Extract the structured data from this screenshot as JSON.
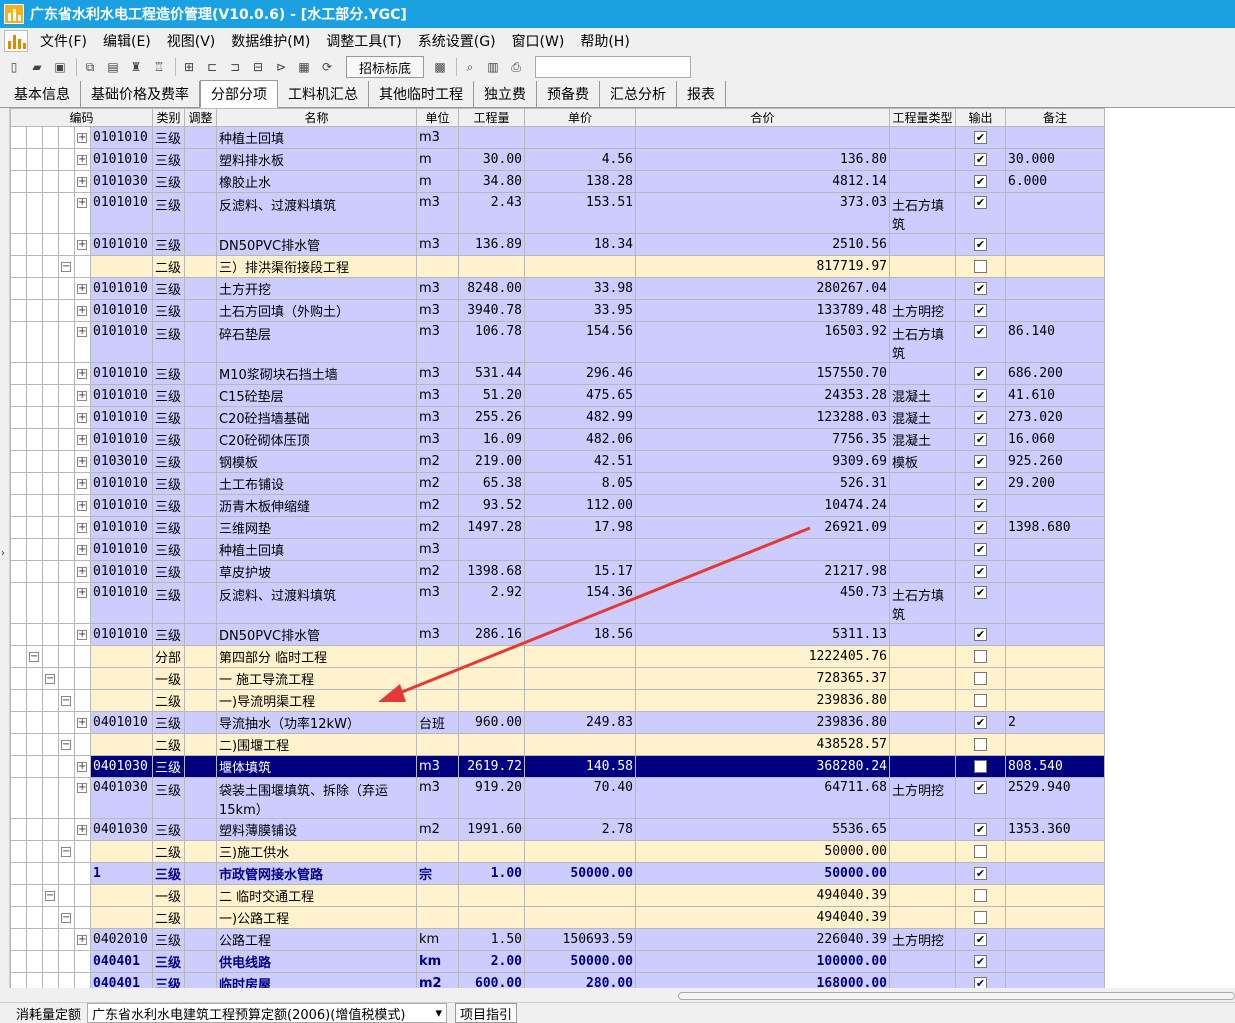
{
  "window": {
    "title": "广东省水利水电工程造价管理(V10.0.6) - [水工部分.YGC]"
  },
  "menu": [
    "文件(F)",
    "编辑(E)",
    "视图(V)",
    "数据维护(M)",
    "调整工具(T)",
    "系统设置(G)",
    "窗口(W)",
    "帮助(H)"
  ],
  "toolbar": {
    "bid_button": "招标标底"
  },
  "tabs": [
    "基本信息",
    "基础价格及费率",
    "分部分项",
    "工料机汇总",
    "其他临时工程",
    "独立费",
    "预备费",
    "汇总分析",
    "报表"
  ],
  "active_tab": 2,
  "columns": [
    "编码",
    "类别",
    "调整",
    "名称",
    "单位",
    "工程量",
    "单价",
    "合价",
    "工程量类型",
    "输出",
    "备注"
  ],
  "rows": [
    {
      "code": "0101010",
      "cat": "三级",
      "name": "种植土回填",
      "unit": "m3",
      "qty": "",
      "price": "",
      "total": "",
      "qtype": "",
      "out": "✔",
      "note": ""
    },
    {
      "code": "0101010",
      "cat": "三级",
      "name": "塑料排水板",
      "unit": "m",
      "qty": "30.00",
      "price": "4.56",
      "total": "136.80",
      "qtype": "",
      "out": "✔",
      "note": "30.000"
    },
    {
      "code": "0101030",
      "cat": "三级",
      "name": "橡胶止水",
      "unit": "m",
      "qty": "34.80",
      "price": "138.28",
      "total": "4812.14",
      "qtype": "",
      "out": "✔",
      "note": "6.000"
    },
    {
      "code": "0101010",
      "cat": "三级",
      "name": "反滤料、过渡料填筑",
      "unit": "m3",
      "qty": "2.43",
      "price": "153.51",
      "total": "373.03",
      "qtype": "土石方填筑",
      "out": "✔",
      "note": ""
    },
    {
      "code": "0101010",
      "cat": "三级",
      "name": "DN50PVC排水管",
      "unit": "m3",
      "qty": "136.89",
      "price": "18.34",
      "total": "2510.56",
      "qtype": "",
      "out": "✔",
      "note": ""
    },
    {
      "code": "",
      "cat": "二级",
      "name": "三）排洪渠衔接段工程",
      "unit": "",
      "qty": "",
      "price": "",
      "total": "817719.97",
      "qtype": "",
      "out": "",
      "note": ""
    },
    {
      "code": "0101010",
      "cat": "三级",
      "name": "土方开挖",
      "unit": "m3",
      "qty": "8248.00",
      "price": "33.98",
      "total": "280267.04",
      "qtype": "",
      "out": "✔",
      "note": ""
    },
    {
      "code": "0101010",
      "cat": "三级",
      "name": "土石方回填（外购土）",
      "unit": "m3",
      "qty": "3940.78",
      "price": "33.95",
      "total": "133789.48",
      "qtype": "土方明挖",
      "out": "✔",
      "note": ""
    },
    {
      "code": "0101010",
      "cat": "三级",
      "name": "碎石垫层",
      "unit": "m3",
      "qty": "106.78",
      "price": "154.56",
      "total": "16503.92",
      "qtype": "土石方填筑",
      "out": "✔",
      "note": "86.140"
    },
    {
      "code": "0101010",
      "cat": "三级",
      "name": "M10浆砌块石挡土墙",
      "unit": "m3",
      "qty": "531.44",
      "price": "296.46",
      "total": "157550.70",
      "qtype": "",
      "out": "✔",
      "note": "686.200"
    },
    {
      "code": "0101010",
      "cat": "三级",
      "name": "C15砼垫层",
      "unit": "m3",
      "qty": "51.20",
      "price": "475.65",
      "total": "24353.28",
      "qtype": "混凝土",
      "out": "✔",
      "note": "41.610"
    },
    {
      "code": "0101010",
      "cat": "三级",
      "name": "C20砼挡墙基础",
      "unit": "m3",
      "qty": "255.26",
      "price": "482.99",
      "total": "123288.03",
      "qtype": "混凝土",
      "out": "✔",
      "note": "273.020"
    },
    {
      "code": "0101010",
      "cat": "三级",
      "name": "C20砼砌体压顶",
      "unit": "m3",
      "qty": "16.09",
      "price": "482.06",
      "total": "7756.35",
      "qtype": "混凝土",
      "out": "✔",
      "note": "16.060"
    },
    {
      "code": "0103010",
      "cat": "三级",
      "name": "钢模板",
      "unit": "m2",
      "qty": "219.00",
      "price": "42.51",
      "total": "9309.69",
      "qtype": "模板",
      "out": "✔",
      "note": "925.260"
    },
    {
      "code": "0101010",
      "cat": "三级",
      "name": "土工布铺设",
      "unit": "m2",
      "qty": "65.38",
      "price": "8.05",
      "total": "526.31",
      "qtype": "",
      "out": "✔",
      "note": "29.200"
    },
    {
      "code": "0101010",
      "cat": "三级",
      "name": "沥青木板伸缩缝",
      "unit": "m2",
      "qty": "93.52",
      "price": "112.00",
      "total": "10474.24",
      "qtype": "",
      "out": "✔",
      "note": ""
    },
    {
      "code": "0101010",
      "cat": "三级",
      "name": "三维网垫",
      "unit": "m2",
      "qty": "1497.28",
      "price": "17.98",
      "total": "26921.09",
      "qtype": "",
      "out": "✔",
      "note": "1398.680"
    },
    {
      "code": "0101010",
      "cat": "三级",
      "name": "种植土回填",
      "unit": "m3",
      "qty": "",
      "price": "",
      "total": "",
      "qtype": "",
      "out": "✔",
      "note": ""
    },
    {
      "code": "0101010",
      "cat": "三级",
      "name": "草皮护坡",
      "unit": "m2",
      "qty": "1398.68",
      "price": "15.17",
      "total": "21217.98",
      "qtype": "",
      "out": "✔",
      "note": ""
    },
    {
      "code": "0101010",
      "cat": "三级",
      "name": "反滤料、过渡料填筑",
      "unit": "m3",
      "qty": "2.92",
      "price": "154.36",
      "total": "450.73",
      "qtype": "土石方填筑",
      "out": "✔",
      "note": ""
    },
    {
      "code": "0101010",
      "cat": "三级",
      "name": "DN50PVC排水管",
      "unit": "m3",
      "qty": "286.16",
      "price": "18.56",
      "total": "5311.13",
      "qtype": "",
      "out": "✔",
      "note": ""
    },
    {
      "code": "",
      "cat": "分部",
      "name": "第四部分  临时工程",
      "unit": "",
      "qty": "",
      "price": "",
      "total": "1222405.76",
      "qtype": "",
      "out": "",
      "note": ""
    },
    {
      "code": "",
      "cat": "一级",
      "name": "一  施工导流工程",
      "unit": "",
      "qty": "",
      "price": "",
      "total": "728365.37",
      "qtype": "",
      "out": "",
      "note": ""
    },
    {
      "code": "",
      "cat": "二级",
      "name": "一)导流明渠工程",
      "unit": "",
      "qty": "",
      "price": "",
      "total": "239836.80",
      "qtype": "",
      "out": "",
      "note": ""
    },
    {
      "code": "0401010",
      "cat": "三级",
      "name": "导流抽水（功率12kW）",
      "unit": "台班",
      "qty": "960.00",
      "price": "249.83",
      "total": "239836.80",
      "qtype": "",
      "out": "✔",
      "note": "2"
    },
    {
      "code": "",
      "cat": "二级",
      "name": "二)围堰工程",
      "unit": "",
      "qty": "",
      "price": "",
      "total": "438528.57",
      "qtype": "",
      "out": "",
      "note": ""
    },
    {
      "code": "0401030",
      "cat": "三级",
      "name": "堰体填筑",
      "unit": "m3",
      "qty": "2619.72",
      "price": "140.58",
      "total": "368280.24",
      "qtype": "",
      "out": "✔",
      "note": "808.540"
    },
    {
      "code": "0401030",
      "cat": "三级",
      "name": "袋装土围堰填筑、拆除（弃运15km）",
      "unit": "m3",
      "qty": "919.20",
      "price": "70.40",
      "total": "64711.68",
      "qtype": "土方明挖",
      "out": "✔",
      "note": "2529.940"
    },
    {
      "code": "0401030",
      "cat": "三级",
      "name": "塑料薄膜铺设",
      "unit": "m2",
      "qty": "1991.60",
      "price": "2.78",
      "total": "5536.65",
      "qtype": "",
      "out": "✔",
      "note": "1353.360"
    },
    {
      "code": "",
      "cat": "二级",
      "name": "三)施工供水",
      "unit": "",
      "qty": "",
      "price": "",
      "total": "50000.00",
      "qtype": "",
      "out": "",
      "note": ""
    },
    {
      "code": "1",
      "cat": "三级",
      "name": "市政管网接水管路",
      "unit": "宗",
      "qty": "1.00",
      "price": "50000.00",
      "total": "50000.00",
      "qtype": "",
      "out": "✔",
      "note": ""
    },
    {
      "code": "",
      "cat": "一级",
      "name": "二  临时交通工程",
      "unit": "",
      "qty": "",
      "price": "",
      "total": "494040.39",
      "qtype": "",
      "out": "",
      "note": ""
    },
    {
      "code": "",
      "cat": "二级",
      "name": "一)公路工程",
      "unit": "",
      "qty": "",
      "price": "",
      "total": "494040.39",
      "qtype": "",
      "out": "",
      "note": ""
    },
    {
      "code": "0402010",
      "cat": "三级",
      "name": "公路工程",
      "unit": "km",
      "qty": "1.50",
      "price": "150693.59",
      "total": "226040.39",
      "qtype": "土方明挖",
      "out": "✔",
      "note": ""
    },
    {
      "code": "040401",
      "cat": "三级",
      "name": "供电线路",
      "unit": "km",
      "qty": "2.00",
      "price": "50000.00",
      "total": "100000.00",
      "qtype": "",
      "out": "✔",
      "note": ""
    },
    {
      "code": "040401",
      "cat": "三级",
      "name": "临时房屋",
      "unit": "m2",
      "qty": "600.00",
      "price": "280.00",
      "total": "168000.00",
      "qtype": "",
      "out": "✔",
      "note": ""
    }
  ],
  "status": {
    "label": "消耗量定额",
    "quota": "广东省水利水电建筑工程预算定额(2006)(增值税模式)",
    "guide": "项目指引"
  }
}
